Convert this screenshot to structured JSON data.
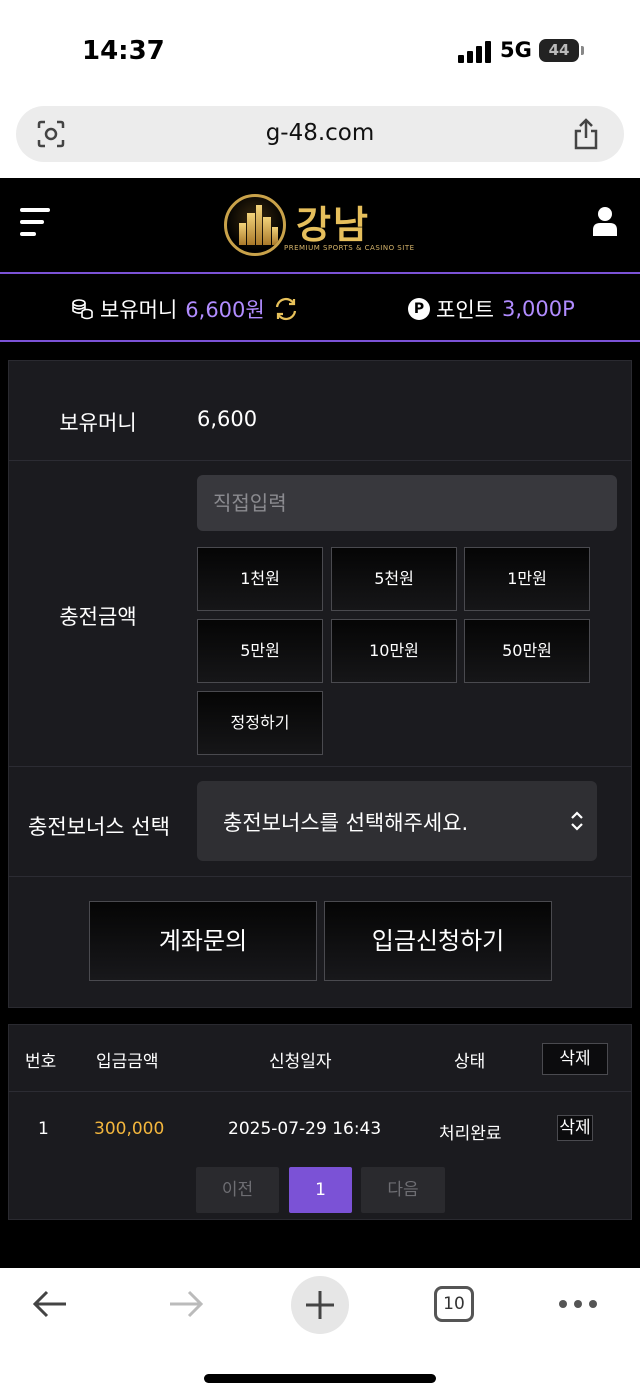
{
  "status_bar": {
    "time": "14:37",
    "network": "5G",
    "battery": "44"
  },
  "browser": {
    "url": "g-48.com",
    "tab_count": "10"
  },
  "header": {
    "logo_text": "강남",
    "logo_sub": "PREMIUM SPORTS & CASINO SITE"
  },
  "balance": {
    "money_label": "보유머니",
    "money_value": "6,600원",
    "point_badge": "P",
    "point_label": "포인트",
    "point_value": "3,000P"
  },
  "form": {
    "money_label": "보유머니",
    "money_value": "6,600",
    "amount_label": "충전금액",
    "amount_placeholder": "직접입력",
    "amount_buttons": [
      "1천원",
      "5천원",
      "1만원",
      "5만원",
      "10만원",
      "50만원",
      "정정하기"
    ],
    "bonus_label": "충전보너스 선택",
    "bonus_selected": "충전보너스를 선택해주세요.",
    "inquiry_button": "계좌문의",
    "submit_button": "입금신청하기"
  },
  "history": {
    "columns": [
      "번호",
      "입금금액",
      "신청일자",
      "상태"
    ],
    "delete_all": "삭제",
    "rows": [
      {
        "no": "1",
        "amount": "300,000",
        "date": "2025-07-29 16:43",
        "status": "처리완료",
        "delete": "삭제"
      }
    ],
    "pagination": {
      "prev": "이전",
      "current": "1",
      "next": "다음"
    }
  },
  "colors": {
    "accent": "#7b52d6",
    "gold": "#f3b63d",
    "panel": "#1b1b1f"
  }
}
